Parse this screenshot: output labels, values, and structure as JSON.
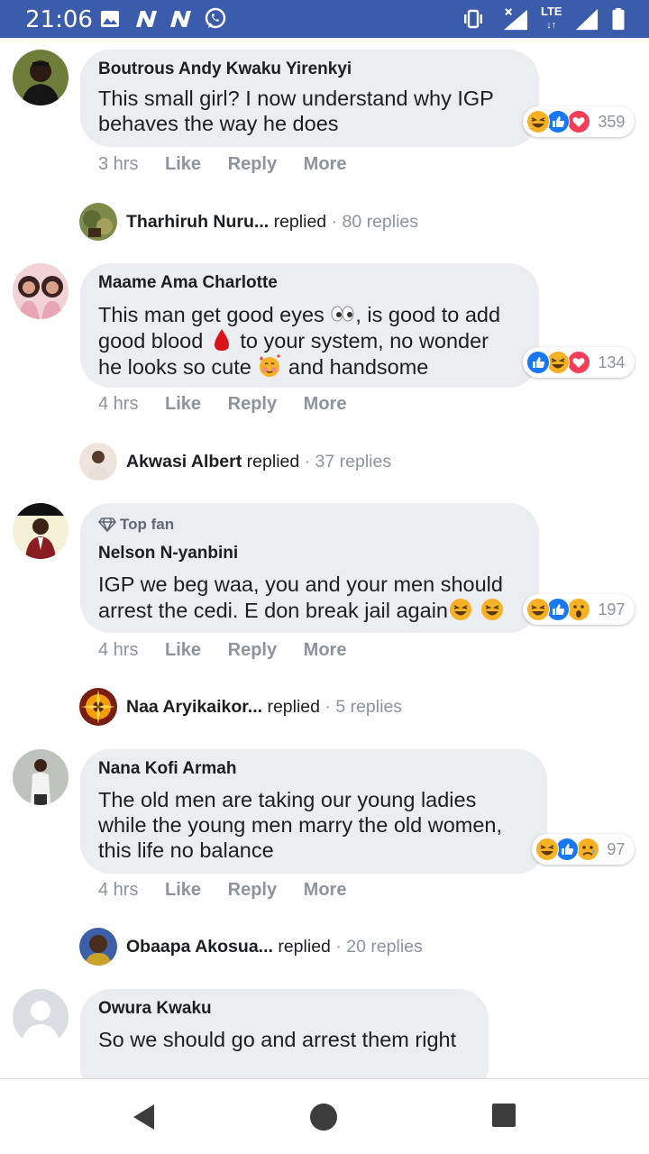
{
  "status_bar": {
    "time": "21:06",
    "network_label": "LTE",
    "icons": [
      "gallery-icon",
      "n-icon",
      "n-icon",
      "whatsapp-icon",
      "vibrate-icon",
      "signal-x-icon",
      "lte-icon",
      "signal-icon",
      "battery-icon"
    ]
  },
  "comments": [
    {
      "author": "Boutrous Andy Kwaku Yirenkyi",
      "lines": [
        "This small girl? I now understand why IGP",
        "behaves the way he does"
      ],
      "reaction_count": "359",
      "reactions": [
        "haha",
        "like",
        "love"
      ],
      "time": "3 hrs",
      "like": "Like",
      "reply": "Reply",
      "more": "More",
      "reply_summary": {
        "name": "Tharhiruh Nuru...",
        "verb": "replied",
        "count": "· 80 replies"
      }
    },
    {
      "author": "Maame Ama Charlotte",
      "lines": [
        "This man get good eyes",
        "good blood",
        "he looks so cute"
      ],
      "line_suffixes": [
        ", is good to add",
        "to your system, no wonder",
        "and handsome"
      ],
      "reaction_count": "134",
      "reactions": [
        "like",
        "haha",
        "love"
      ],
      "time": "4 hrs",
      "like": "Like",
      "reply": "Reply",
      "more": "More",
      "reply_summary": {
        "name": "Akwasi Albert",
        "verb": "replied",
        "count": "· 37 replies"
      }
    },
    {
      "badge": "Top fan",
      "author": "Nelson N-yanbini",
      "lines": [
        "IGP we beg waa, you and your men should",
        "arrest the cedi. E don break jail again"
      ],
      "reaction_count": "197",
      "reactions": [
        "haha",
        "like",
        "wow"
      ],
      "time": "4 hrs",
      "like": "Like",
      "reply": "Reply",
      "more": "More",
      "reply_summary": {
        "name": "Naa Aryikaikor...",
        "verb": "replied",
        "count": "· 5 replies"
      }
    },
    {
      "author": "Nana Kofi Armah",
      "lines": [
        "The old men are taking our young ladies",
        "while the young men marry the old women,",
        "this life no balance"
      ],
      "reaction_count": "97",
      "reactions": [
        "haha",
        "like",
        "sad"
      ],
      "time": "4 hrs",
      "like": "Like",
      "reply": "Reply",
      "more": "More",
      "reply_summary": {
        "name": "Obaapa Akosua...",
        "verb": "replied",
        "count": "· 20 replies"
      }
    },
    {
      "author": "Owura Kwaku",
      "lines": [
        "So we should go and arrest them right"
      ]
    }
  ],
  "colors": {
    "status_bar": "#3b5bab",
    "bubble": "#ebedf0",
    "like_blue": "#1877f2",
    "love_red": "#f33e58",
    "haha_yellow": "#f7b125",
    "meta_gray": "#8d949e"
  }
}
